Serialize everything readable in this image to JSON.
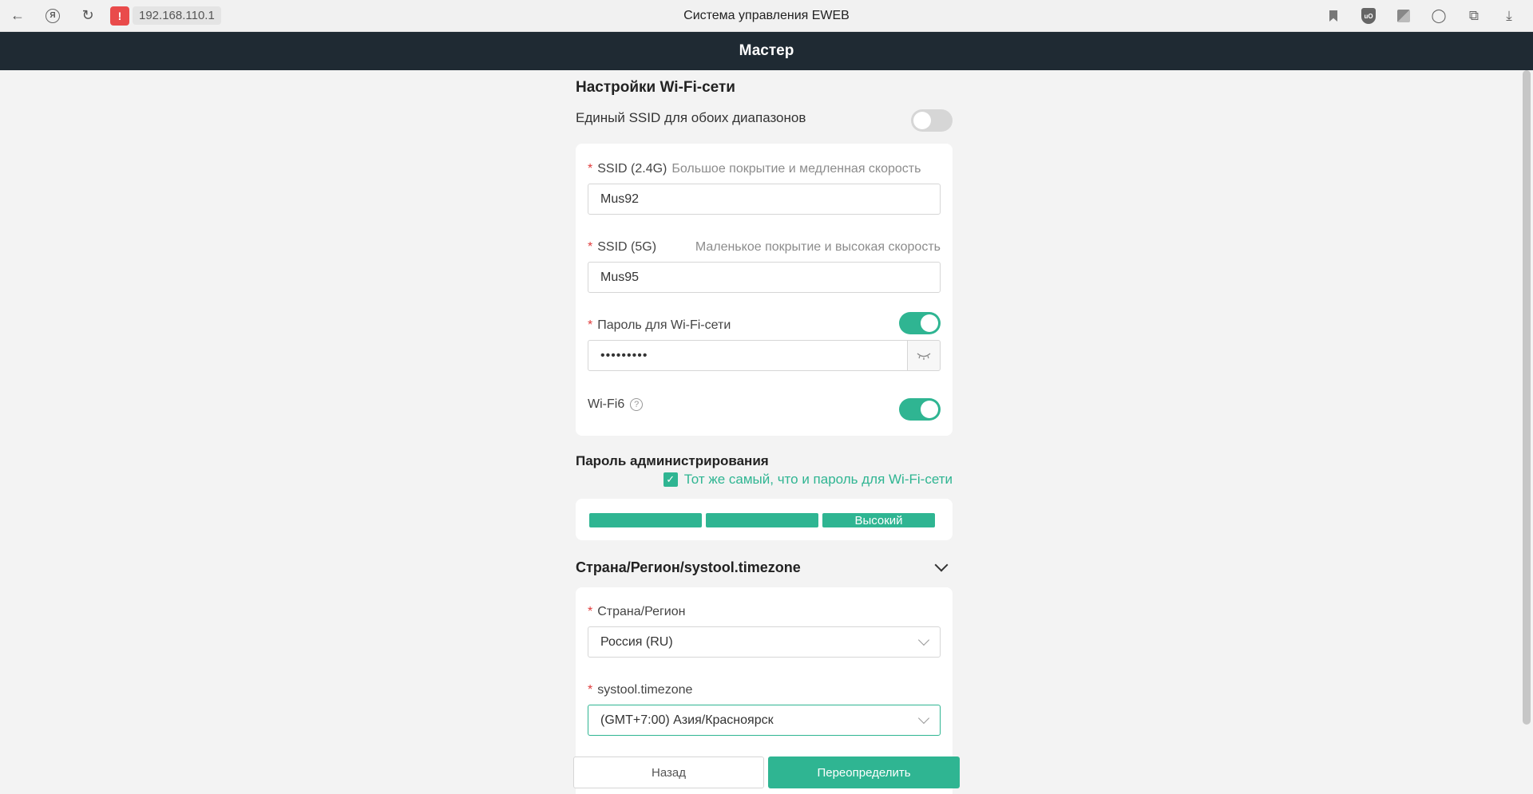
{
  "browser": {
    "url": "192.168.110.1",
    "title": "Система управления EWEB",
    "warn_glyph": "!"
  },
  "header": {
    "title": "Мастер"
  },
  "wifi": {
    "section_title": "Настройки Wi-Fi-сети",
    "unified_ssid_label": "Единый SSID для обоих диапазонов",
    "unified_ssid_enabled": false,
    "ssid24": {
      "label": "SSID (2.4G)",
      "hint": "Большое покрытие и медленная скорость",
      "value": "Mus92"
    },
    "ssid5": {
      "label": "SSID (5G)",
      "hint": "Маленькое покрытие и высокая скорость",
      "value": "Mus95"
    },
    "password": {
      "label": "Пароль для Wi-Fi-сети",
      "value": "•••••••••",
      "enabled": true
    },
    "wifi6": {
      "label": "Wi-Fi6",
      "enabled": true
    }
  },
  "admin": {
    "section_title": "Пароль администрирования",
    "same_checkbox_label": "Тот же самый, что и пароль для Wi-Fi-сети",
    "same_checked": true,
    "strength_label": "Высокий",
    "strength_level": "3 of 3"
  },
  "region": {
    "section_title": "Страна/Регион/systool.timezone",
    "country_label": "Страна/Регион",
    "country_value": "Россия (RU)",
    "timezone_label": "systool.timezone",
    "timezone_value": "(GMT+7:00) Азия/Красноярск"
  },
  "footer": {
    "back_label": "Назад",
    "override_label": "Переопределить"
  },
  "colors": {
    "accent": "#2fb592",
    "header_bg": "#1f2a33",
    "required": "#e03c3c"
  }
}
